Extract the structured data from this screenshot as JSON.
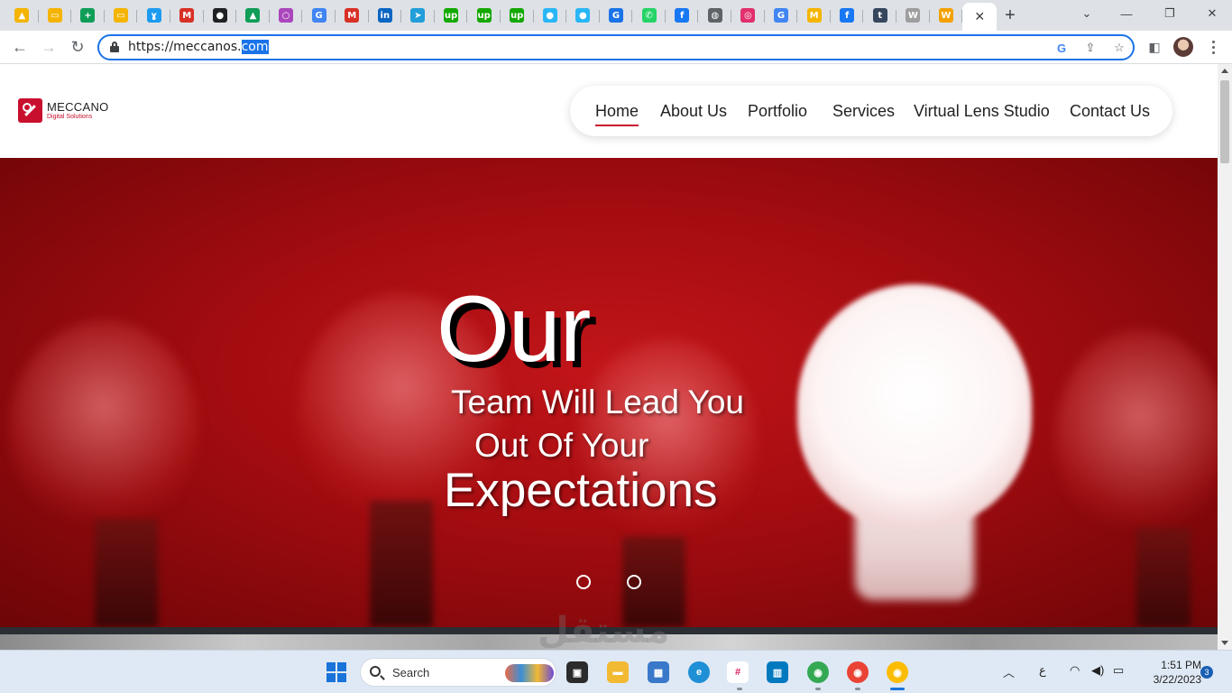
{
  "browser": {
    "tab_favicons": [
      {
        "icon": "google-drive-icon",
        "glyph": "▲",
        "color": "#f4b400"
      },
      {
        "icon": "google-slides-icon",
        "glyph": "▭",
        "color": "#f4b400"
      },
      {
        "icon": "google-sheets-icon",
        "glyph": "+",
        "color": "#0f9d58"
      },
      {
        "icon": "google-slides-icon",
        "glyph": "▭",
        "color": "#f4b400"
      },
      {
        "icon": "bird-icon",
        "glyph": "ɣ",
        "color": "#1d9bf0"
      },
      {
        "icon": "gmail-icon",
        "glyph": "M",
        "color": "#d93025"
      },
      {
        "icon": "dark-app-icon",
        "glyph": "●",
        "color": "#202124"
      },
      {
        "icon": "google-drive-icon",
        "glyph": "▲",
        "color": "#0f9d58"
      },
      {
        "icon": "ring-icon",
        "glyph": "○",
        "color": "#ab47bc"
      },
      {
        "icon": "google-translate-icon",
        "glyph": "G",
        "color": "#4285f4"
      },
      {
        "icon": "gmail-icon",
        "glyph": "M",
        "color": "#d93025"
      },
      {
        "icon": "linkedin-icon",
        "glyph": "in",
        "color": "#0a66c2"
      },
      {
        "icon": "telegram-icon",
        "glyph": "➤",
        "color": "#229ed9"
      },
      {
        "icon": "upwork-icon",
        "glyph": "up",
        "color": "#14a800"
      },
      {
        "icon": "upwork-icon",
        "glyph": "up",
        "color": "#14a800"
      },
      {
        "icon": "upwork-icon",
        "glyph": "up",
        "color": "#14a800"
      },
      {
        "icon": "circle-icon",
        "glyph": "●",
        "color": "#29b6f6"
      },
      {
        "icon": "circle-icon",
        "glyph": "●",
        "color": "#29b6f6"
      },
      {
        "icon": "grammarly-icon",
        "glyph": "G",
        "color": "#1a73e8"
      },
      {
        "icon": "whatsapp-icon",
        "glyph": "✆",
        "color": "#25d366"
      },
      {
        "icon": "facebook-icon",
        "glyph": "f",
        "color": "#1877f2"
      },
      {
        "icon": "globe-icon",
        "glyph": "◍",
        "color": "#5f6368"
      },
      {
        "icon": "instagram-icon",
        "glyph": "◎",
        "color": "#e1306c"
      },
      {
        "icon": "google-icon",
        "glyph": "G",
        "color": "#4285f4"
      },
      {
        "icon": "gmail-icon",
        "glyph": "M",
        "color": "#f4b400"
      },
      {
        "icon": "facebook-icon",
        "glyph": "f",
        "color": "#1877f2"
      },
      {
        "icon": "tumblr-icon",
        "glyph": "t",
        "color": "#36465d"
      },
      {
        "icon": "web-search-icon",
        "glyph": "W",
        "color": "#9e9e9e"
      },
      {
        "icon": "w-app-icon",
        "glyph": "W",
        "color": "#f4a100"
      }
    ],
    "url_main": "https://meccanos.",
    "url_selected": "com"
  },
  "site": {
    "logo_name": "MECCANO",
    "logo_tagline": "Digital Solutions",
    "nav": [
      {
        "label": "Home",
        "active": true
      },
      {
        "label": "About Us",
        "active": false
      },
      {
        "label": "Portfolio",
        "active": false
      },
      {
        "label": "Services",
        "active": false
      },
      {
        "label": "Virtual Lens Studio",
        "active": false
      },
      {
        "label": "Contact Us",
        "active": false
      }
    ],
    "hero": {
      "line1": "Our",
      "line2": "Team Will Lead You",
      "line3": "Out Of Your",
      "line4": "Expectations"
    },
    "watermark": "مستقل"
  },
  "taskbar": {
    "search_label": "Search",
    "tray_language": "ع",
    "time": "1:51 PM",
    "date": "3/22/2023",
    "notification_count": "3"
  },
  "colors": {
    "brand_red": "#c8102e",
    "omnibox_focus": "#1a73e8",
    "hero_red": "#b01216"
  }
}
